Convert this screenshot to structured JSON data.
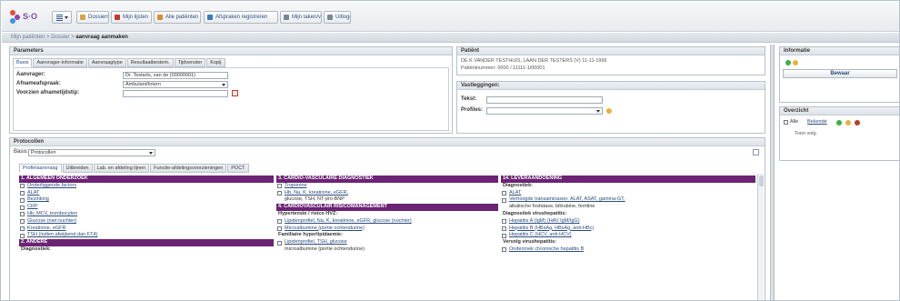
{
  "app": {
    "logo_text": "S·O"
  },
  "toolbar": {
    "buttons": [
      {
        "label": "Dossiers",
        "icon": "folder-icon",
        "color": "#d9a441"
      },
      {
        "label": "Mijn lijsten",
        "icon": "person-icon",
        "color": "#c0392b"
      },
      {
        "label": "Alle patiënten",
        "icon": "people-icon",
        "color": "#e08a2e"
      },
      {
        "label": "Afspraken registreren",
        "icon": "calendar-icon",
        "color": "#3a7bbf"
      },
      {
        "label": "Mijn taken/vragen",
        "icon": "tasks-icon",
        "color": "#7a8894"
      },
      {
        "label": "Uitloggen",
        "icon": "logout-icon",
        "color": "#7a8894"
      }
    ]
  },
  "breadcrumb": {
    "path": "Mijn patiënten > Dossier > ",
    "current": "aanvraag aanmaken"
  },
  "parameters": {
    "title": "Parameters",
    "tabs": [
      "Basis",
      "Aanvrager-informatie",
      "Aanvraagtype",
      "Resultaatbestem.",
      "Tijdvenster",
      "Kopij"
    ],
    "fields": [
      {
        "label": "Aanvrager:",
        "value": "Dr. Testarts, van de (00000001)"
      },
      {
        "label": "Afnameafspraak:",
        "value": "Ambulant/Intern"
      },
      {
        "label": "Voorzien afnametijdstip:",
        "value": ""
      }
    ]
  },
  "patient": {
    "title": "Patiënt",
    "line1": "DE K VANDER TESTHUIS, LAAN DER TESTERS (V) 11-11-1966",
    "line2": "Patiëntnummer: 0000 / 11111-1/00001"
  },
  "notes": {
    "title": "Vastleggingen:",
    "fields": [
      {
        "label": "Tekst:",
        "value": ""
      },
      {
        "label": "Profiles:",
        "value": ""
      }
    ]
  },
  "info": {
    "title": "Informatie",
    "button": "Bewaar"
  },
  "overview": {
    "title": "Overzicht",
    "check_label": "Alle",
    "filter_label": "Bekende",
    "sub_label": "Toon volg."
  },
  "protocols": {
    "title": "Protocollen",
    "filter_label": "Basis:",
    "filter_value": "Protocollen",
    "tabs": [
      "Profielaanvraag",
      "Uitbreiden",
      "Lab. en afdeling lijnen",
      "Functie-afdelingsvoorzieningen",
      "POCT"
    ],
    "col1": [
      {
        "type": "head",
        "text": "1. ALGEMEEN ONDERZOEK"
      },
      {
        "type": "check",
        "text": "Onderliggende factors"
      },
      {
        "type": "check",
        "text": "ALAT"
      },
      {
        "type": "check",
        "text": "Bezinking"
      },
      {
        "type": "check",
        "text": "CRP"
      },
      {
        "type": "check",
        "text": "Hb, MCV, trombocyten"
      },
      {
        "type": "check",
        "text": "Glucose (niet nuchter)"
      },
      {
        "type": "check",
        "text": "Kreatinine, eGFR"
      },
      {
        "type": "check",
        "text": "TSH (indien afwijkend dan FT4)"
      },
      {
        "type": "head",
        "text": "2. ANDERE"
      },
      {
        "type": "sub",
        "text": "Diagnostiek:"
      }
    ],
    "col2": [
      {
        "type": "head",
        "text": "3. CARDIO-VASCULAIRE DIAGNOSTIEK"
      },
      {
        "type": "check",
        "text": "Troponine"
      },
      {
        "type": "check",
        "text": "Hb, Na, K, kreatinine, eGFR,"
      },
      {
        "type": "plain",
        "text": "glucose, TSH, NT-pro-BNP"
      },
      {
        "type": "head",
        "text": "4. CARDIOVASCULAIR RISICOMANAGEMENT"
      },
      {
        "type": "sub",
        "text": "Hypertensie / risico HVZ:"
      },
      {
        "type": "check",
        "text": "Lipidenprofiel, Na, K, kreatinine, eGFR, glucose (nuchter)"
      },
      {
        "type": "check",
        "text": "Microalbumine (portie ochtendurine)"
      },
      {
        "type": "sub",
        "text": "Familiaire hyperlipidaemie:"
      },
      {
        "type": "check",
        "text": "Lipidenprofiel, TSH, glucose"
      },
      {
        "type": "plain",
        "text": "microalbumine (portie ochtendurine)"
      }
    ],
    "col3": [
      {
        "type": "head",
        "text": "14. LEVERAANDOENING"
      },
      {
        "type": "sub",
        "text": "Diagnostiek:"
      },
      {
        "type": "check",
        "text": "ALAT"
      },
      {
        "type": "check",
        "text": "Verhoogde transaminasen: ALAT, ASAT, gamma-GT,"
      },
      {
        "type": "plain",
        "text": "alkalische fosfatase, bilirubine, ferritine"
      },
      {
        "type": "sub",
        "text": "Diagnostiek virushepatitis:"
      },
      {
        "type": "check",
        "text": "Hepatitis A (IgM) (HAV IgM/IgG)"
      },
      {
        "type": "check",
        "text": "Hepatitis B (HBsAg, HBsAg, anti-HBc)"
      },
      {
        "type": "check",
        "text": "Hepatitis C (HCV, anti-HCV)"
      },
      {
        "type": "sub",
        "text": "Vervolg virushepatitis:"
      },
      {
        "type": "check",
        "text": "Onderzoek chronische hepatitis B"
      }
    ]
  },
  "colors": {
    "section_header": "#6b2374",
    "link": "#2b4c7e"
  }
}
